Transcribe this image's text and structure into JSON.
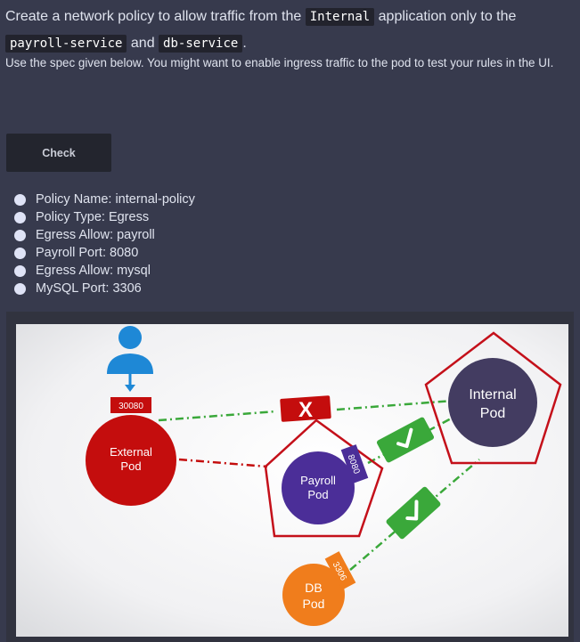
{
  "question": {
    "intro_text": "Create a network policy to allow traffic from the",
    "internal_code": "Internal",
    "mid_text": "application only to the",
    "payroll_code": "payroll-service",
    "and_text": "and",
    "db_code": "db-service",
    "period": ".",
    "description": "Use the spec given below. You might want to enable ingress traffic to the pod to test your rules in the UI."
  },
  "check_button": {
    "label": "Check"
  },
  "spec_items": [
    "Policy Name: internal-policy",
    "Policy Type: Egress",
    "Egress Allow: payroll",
    "Payroll Port: 8080",
    "Egress Allow: mysql",
    "MySQL Port: 3306"
  ],
  "diagram": {
    "external_port": "30080",
    "external_pod": [
      "External",
      "Pod"
    ],
    "payroll_pod": [
      "Payroll",
      "Pod"
    ],
    "payroll_port": "8080",
    "internal_pod": [
      "Internal",
      "Pod"
    ],
    "db_pod": [
      "DB",
      "Pod"
    ],
    "db_port": "3306",
    "blocked_mark": "X",
    "colors": {
      "user": "#1e88d6",
      "external": "#c40d0d",
      "payroll": "#4b2e98",
      "internal": "#433c61",
      "db": "#f07d1c",
      "allowed": "#3aa83a",
      "blocked": "#c40d0d",
      "policy_outline": "#c4101a"
    }
  }
}
